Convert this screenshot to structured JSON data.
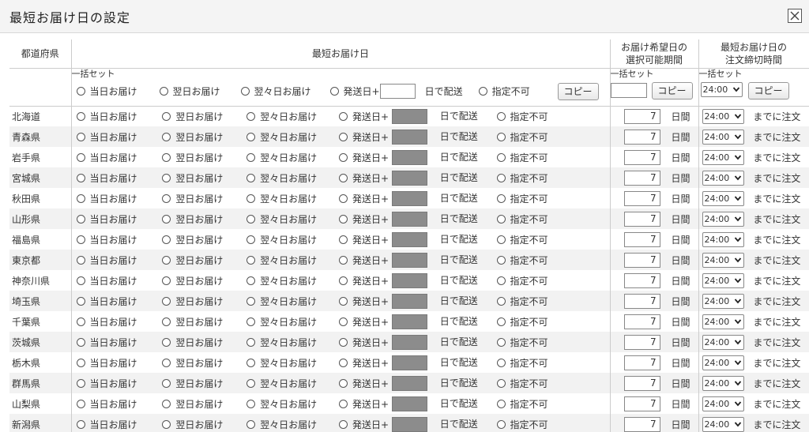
{
  "dialog": {
    "title": "最短お届け日の設定"
  },
  "headers": {
    "prefecture": "都道府県",
    "shortest_date": "最短お届け日",
    "selectable_period_line1": "お届け希望日の",
    "selectable_period_line2": "選択可能期間",
    "cutoff_line1": "最短お届け日の",
    "cutoff_line2": "注文締切時間"
  },
  "bulk": {
    "label": "一括セット",
    "copy_label": "コピー",
    "cutoff_value": "24:00"
  },
  "options": {
    "same_day": "当日お届け",
    "next_day": "翌日お届け",
    "day_after_next": "翌々日お届け",
    "ship_plus": "発送日+",
    "ship_suffix": "日で配送",
    "not_specified": "指定不可"
  },
  "period_unit": "日間",
  "cutoff_suffix": "までに注文",
  "rows": [
    {
      "prefecture": "北海道",
      "period": "7",
      "cutoff": "24:00"
    },
    {
      "prefecture": "青森県",
      "period": "7",
      "cutoff": "24:00"
    },
    {
      "prefecture": "岩手県",
      "period": "7",
      "cutoff": "24:00"
    },
    {
      "prefecture": "宮城県",
      "period": "7",
      "cutoff": "24:00"
    },
    {
      "prefecture": "秋田県",
      "period": "7",
      "cutoff": "24:00"
    },
    {
      "prefecture": "山形県",
      "period": "7",
      "cutoff": "24:00"
    },
    {
      "prefecture": "福島県",
      "period": "7",
      "cutoff": "24:00"
    },
    {
      "prefecture": "東京都",
      "period": "7",
      "cutoff": "24:00"
    },
    {
      "prefecture": "神奈川県",
      "period": "7",
      "cutoff": "24:00"
    },
    {
      "prefecture": "埼玉県",
      "period": "7",
      "cutoff": "24:00"
    },
    {
      "prefecture": "千葉県",
      "period": "7",
      "cutoff": "24:00"
    },
    {
      "prefecture": "茨城県",
      "period": "7",
      "cutoff": "24:00"
    },
    {
      "prefecture": "栃木県",
      "period": "7",
      "cutoff": "24:00"
    },
    {
      "prefecture": "群馬県",
      "period": "7",
      "cutoff": "24:00"
    },
    {
      "prefecture": "山梨県",
      "period": "7",
      "cutoff": "24:00"
    },
    {
      "prefecture": "新潟県",
      "period": "7",
      "cutoff": "24:00"
    }
  ],
  "icons": {
    "close": "close-icon",
    "radio": "radio-icon",
    "dropdown": "chevron-down-icon"
  },
  "colors": {
    "border": "#cccccc",
    "row_alt": "#f2f2f2",
    "disabled_field": "#8c8c8c",
    "titlebar": "#f4f4f4"
  }
}
